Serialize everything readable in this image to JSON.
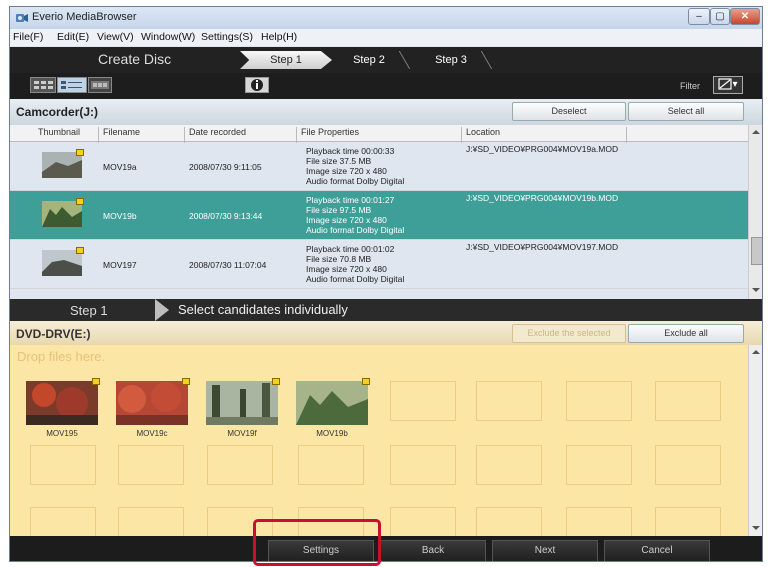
{
  "window": {
    "title": "Everio MediaBrowser"
  },
  "window_controls": {
    "minimize": "–",
    "maximize": "▢",
    "close": "✕"
  },
  "menu": [
    "File(F)",
    "Edit(E)",
    "View(V)",
    "Window(W)",
    "Settings(S)",
    "Help(H)"
  ],
  "steps": {
    "mode": "Create Disc",
    "tabs": [
      "Step 1",
      "Step 2",
      "Step 3"
    ],
    "active": "Step 1"
  },
  "toolbar": {
    "filter_label": "Filter",
    "filter_button": "▾"
  },
  "source": {
    "title": "Camcorder(J:)",
    "deselect": "Deselect",
    "select_all": "Select all",
    "columns": [
      "Thumbnail",
      "Filename",
      "Date recorded",
      "File Properties",
      "Location"
    ],
    "rows": [
      {
        "filename": "MOV19a",
        "date": "2008/07/30 9:11:05",
        "props": [
          "Playback time 00:00:33",
          "File size 37.5 MB",
          "Image size 720 x 480",
          "Audio format Dolby Digital"
        ],
        "location": "J:¥SD_VIDEO¥PRG004¥MOV19a.MOD",
        "selected": false
      },
      {
        "filename": "MOV19b",
        "date": "2008/07/30 9:13:44",
        "props": [
          "Playback time 00:01:27",
          "File size 97.5 MB",
          "Image size 720 x 480",
          "Audio format Dolby Digital"
        ],
        "location": "J:¥SD_VIDEO¥PRG004¥MOV19b.MOD",
        "selected": true
      },
      {
        "filename": "MOV197",
        "date": "2008/07/30 11:07:04",
        "props": [
          "Playback time 00:01:02",
          "File size 70.8 MB",
          "Image size 720 x 480",
          "Audio format Dolby Digital"
        ],
        "location": "J:¥SD_VIDEO¥PRG004¥MOV197.MOD",
        "selected": false
      }
    ]
  },
  "step_strip": {
    "label": "Step 1",
    "description": "Select candidates individually"
  },
  "destination": {
    "title": "DVD-DRV(E:)",
    "exclude_selected": "Exclude the selected",
    "exclude_all": "Exclude all",
    "drop_hint": "Drop files here.",
    "items": [
      "MOV195",
      "MOV19c",
      "MOV19f",
      "MOV19b"
    ]
  },
  "footer": {
    "settings": "Settings",
    "back": "Back",
    "next": "Next",
    "cancel": "Cancel"
  },
  "colors": {
    "selected_row": "#3e9f98",
    "drop_area": "#fbe6a6",
    "highlight": "#c8102e"
  }
}
